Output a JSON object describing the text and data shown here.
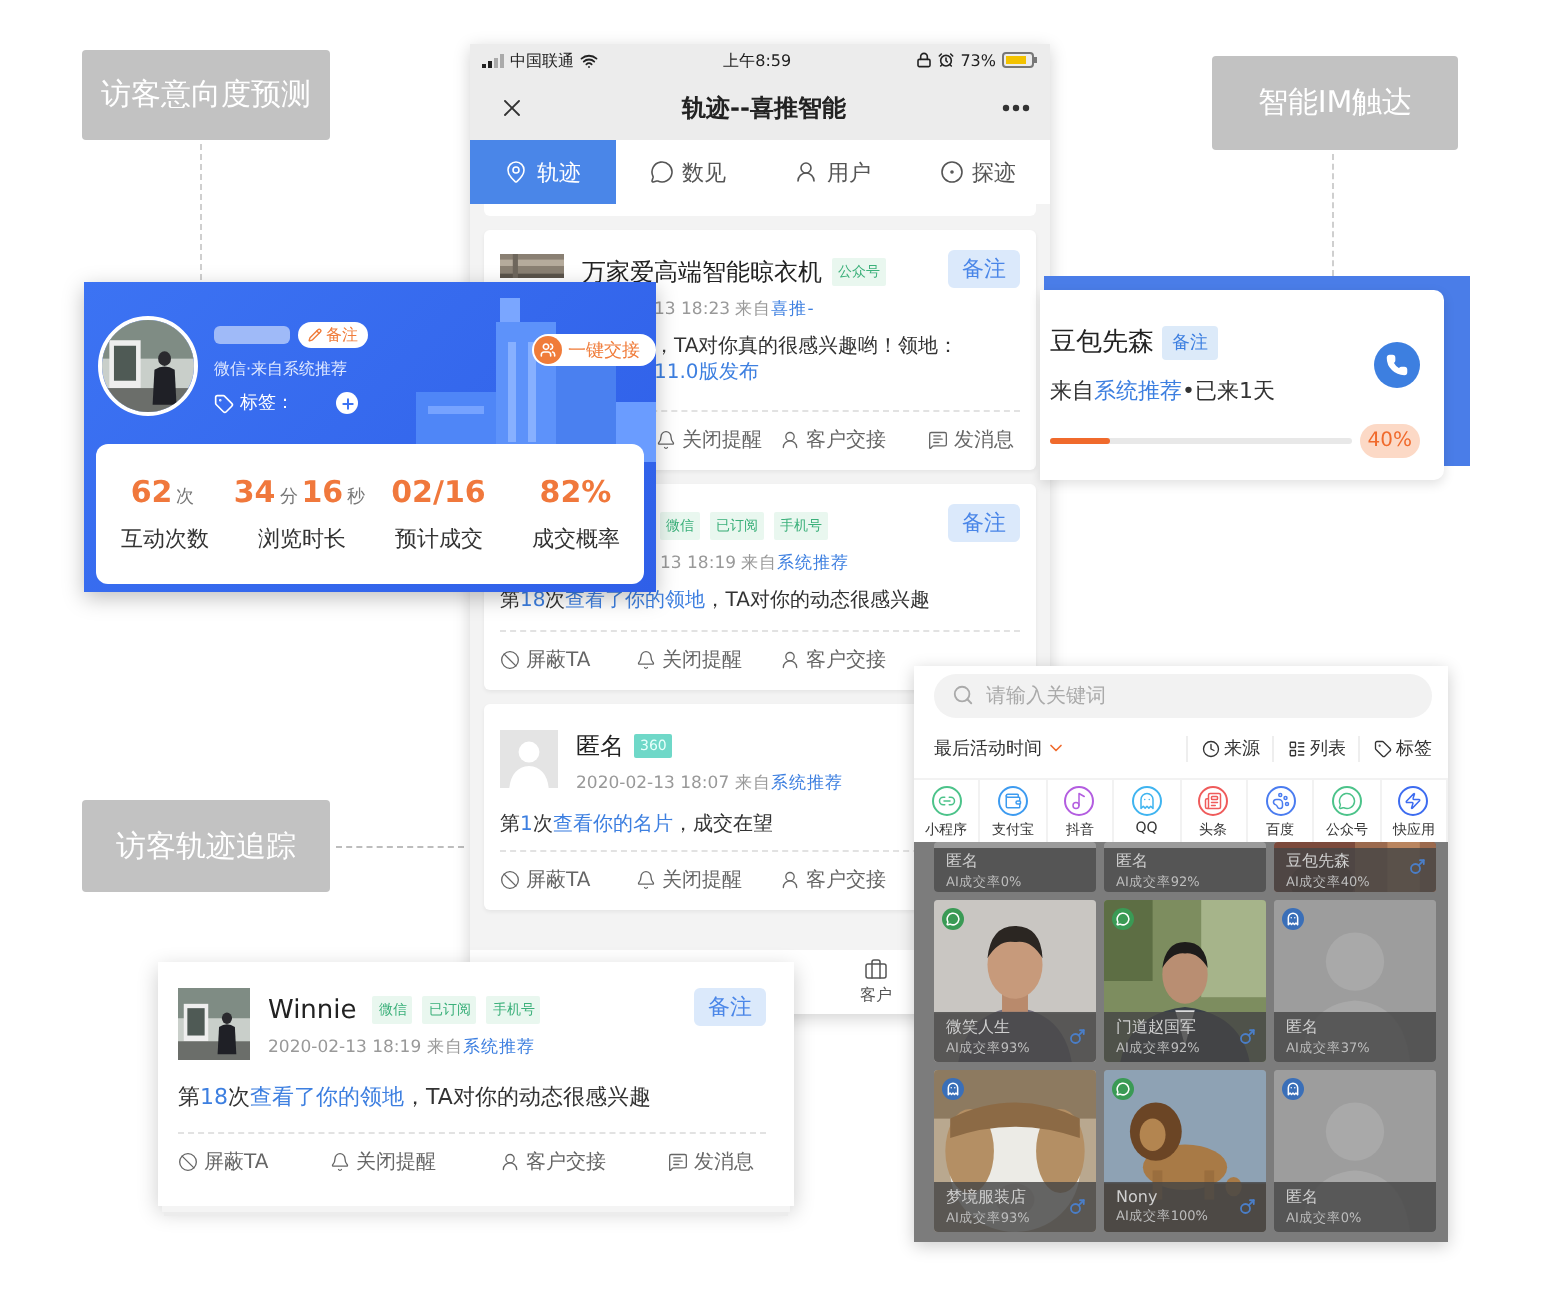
{
  "labels": [
    {
      "text": "访客意向度预测"
    },
    {
      "text": "智能IM触达"
    },
    {
      "text": "访客轨迹追踪"
    }
  ],
  "phone": {
    "carrier": "中国联通",
    "clock": "上午8:59",
    "battery": "73%",
    "title": "轨迹--喜推智能",
    "tabs": [
      {
        "label": "轨迹",
        "selected": true
      },
      {
        "label": "数见",
        "selected": false
      },
      {
        "label": "用户",
        "selected": false
      },
      {
        "label": "探迹",
        "selected": false
      }
    ],
    "cards": [
      {
        "kind": "thumb",
        "title": "万家爱高端智能晾衣机",
        "tags": [
          {
            "text": "公众号",
            "kind": "plain"
          }
        ],
        "note": "备注",
        "meta": [
          {
            "text": "13 18:23  来自"
          },
          {
            "text": "喜推-",
            "link": true
          }
        ],
        "lines": [
          [
            {
              "text": "，TA对你真的很感兴趣哟！领地："
            }
          ],
          [
            {
              "text": "11.0版发布",
              "link": true
            }
          ]
        ],
        "actions": [
          {
            "kind": "mute",
            "label": "关闭提醒"
          },
          {
            "kind": "handover",
            "label": "客户交接"
          },
          {
            "kind": "message",
            "label": "发消息"
          }
        ]
      },
      {
        "kind": "none",
        "tags": [
          {
            "text": "微信",
            "kind": "plain"
          },
          {
            "text": "已订阅",
            "kind": "plain"
          },
          {
            "text": "手机号",
            "kind": "plain"
          }
        ],
        "note": "备注",
        "meta": [
          {
            "text": "13 18:19  来自"
          },
          {
            "text": "系统推荐",
            "link": true
          }
        ],
        "lines": [
          [
            {
              "text": "第"
            },
            {
              "text": "18",
              "em": true
            },
            {
              "text": "次"
            },
            {
              "text": "查看了你的领地",
              "link": true
            },
            {
              "text": "，TA对你的动态很感兴趣"
            }
          ]
        ],
        "actions": [
          {
            "kind": "block",
            "label": "屏蔽TA"
          },
          {
            "kind": "mute",
            "label": "关闭提醒"
          },
          {
            "kind": "handover",
            "label": "客户交接"
          }
        ]
      },
      {
        "kind": "avatar",
        "title": "匿名",
        "tags": [
          {
            "text": "360",
            "kind": "filled"
          }
        ],
        "meta": [
          {
            "text": "2020-02-13 18:07  来自"
          },
          {
            "text": "系统推荐",
            "link": true
          }
        ],
        "lines": [
          [
            {
              "text": "第"
            },
            {
              "text": "1",
              "em": true
            },
            {
              "text": "次"
            },
            {
              "text": "查看你的名片",
              "link": true
            },
            {
              "text": "，成交在望"
            }
          ]
        ],
        "actions": [
          {
            "kind": "block",
            "label": "屏蔽TA"
          },
          {
            "kind": "mute",
            "label": "关闭提醒"
          },
          {
            "kind": "handover",
            "label": "客户交接"
          }
        ]
      }
    ],
    "nav": [
      {
        "label": "客户"
      }
    ]
  },
  "intent_card": {
    "note": "备注",
    "source": "微信·来自系统推荐",
    "tag_label": "标签：",
    "handover": "一键交接",
    "stats": [
      {
        "value": [
          {
            "text": "62"
          },
          {
            "text": "次",
            "unit": true
          }
        ],
        "label": "互动次数"
      },
      {
        "value": [
          {
            "text": "34"
          },
          {
            "text": "分",
            "unit": true
          },
          {
            "text": "16"
          },
          {
            "text": "秒",
            "unit": true
          }
        ],
        "label": "浏览时长"
      },
      {
        "value": [
          {
            "text": "02/16"
          }
        ],
        "label": "预计成交"
      },
      {
        "value": [
          {
            "text": "82%"
          }
        ],
        "label": "成交概率"
      }
    ]
  },
  "im_card": {
    "name": "豆包先森",
    "note": "备注",
    "meta": [
      {
        "text": "来自"
      },
      {
        "text": "系统推荐",
        "link": true
      },
      {
        "text": "•已来1天"
      }
    ],
    "level": 0.2,
    "percent": "40%"
  },
  "grid": {
    "search": {
      "placeholder": "请输入关键词"
    },
    "sort": "最后活动时间",
    "filters": [
      {
        "label": "来源",
        "kind": "source"
      },
      {
        "label": "列表",
        "kind": "list"
      },
      {
        "label": "标签",
        "kind": "tag"
      }
    ],
    "sources": [
      {
        "label": "小程序",
        "kind": "mini",
        "color": "#4cc38a"
      },
      {
        "label": "支付宝",
        "kind": "pay",
        "color": "#3d9bf0"
      },
      {
        "label": "抖音",
        "kind": "music",
        "color": "#b35de0"
      },
      {
        "label": "QQ",
        "kind": "qq",
        "color": "#3fb4f0"
      },
      {
        "label": "头条",
        "kind": "news",
        "color": "#ef5b5b"
      },
      {
        "label": "百度",
        "kind": "paw",
        "color": "#4a7cf0"
      },
      {
        "label": "公众号",
        "kind": "chat",
        "color": "#4cc38a"
      },
      {
        "label": "快应用",
        "kind": "bolt",
        "color": "#3d6cf0"
      }
    ],
    "tiles": [
      {
        "kind": "blank",
        "name": "匿名",
        "rate": "AI成交率0%",
        "male": false
      },
      {
        "kind": "blank",
        "name": "匿名",
        "rate": "AI成交率92%",
        "male": false
      },
      {
        "name": "豆包先森",
        "rate": "AI成交率40%",
        "male": true
      },
      {
        "kind": "person",
        "badge": {
          "kind": "wechat"
        },
        "name": "微笑人生",
        "rate": "AI成交率93%",
        "male": true
      },
      {
        "kind": "person2",
        "badge": {
          "kind": "wechat"
        },
        "name": "门道赵国军",
        "rate": "AI成交率92%",
        "male": true
      },
      {
        "kind": "blank",
        "badge": {
          "kind": "qq"
        },
        "name": "匿名",
        "rate": "AI成交率37%",
        "male": false
      },
      {
        "kind": "dog",
        "badge": {
          "kind": "qq"
        },
        "name": "梦境服装店",
        "rate": "AI成交率93%",
        "male": true
      },
      {
        "kind": "lion",
        "badge": {
          "kind": "wechat"
        },
        "name": "Nony",
        "rate": "AI成交率100%",
        "male": true
      },
      {
        "kind": "blank",
        "badge": {
          "kind": "qq"
        },
        "name": "匿名",
        "rate": "AI成交率0%",
        "male": false
      }
    ]
  },
  "visitor_card": {
    "name": "Winnie",
    "tags": [
      {
        "text": "微信",
        "kind": "plain"
      },
      {
        "text": "已订阅",
        "kind": "plain"
      },
      {
        "text": "手机号",
        "kind": "plain"
      }
    ],
    "note": "备注",
    "meta": [
      {
        "text": "2020-02-13 18:19  来自"
      },
      {
        "text": "系统推荐",
        "link": true
      }
    ],
    "line": [
      {
        "text": "第"
      },
      {
        "text": "18",
        "em": true
      },
      {
        "text": "次"
      },
      {
        "text": "查看了你的领地",
        "link": true
      },
      {
        "text": "，TA对你的动态很感兴趣"
      }
    ],
    "actions": [
      {
        "kind": "block",
        "label": "屏蔽TA"
      },
      {
        "kind": "mute",
        "label": "关闭提醒"
      },
      {
        "kind": "handover",
        "label": "客户交接"
      },
      {
        "kind": "message",
        "label": "发消息"
      }
    ]
  }
}
